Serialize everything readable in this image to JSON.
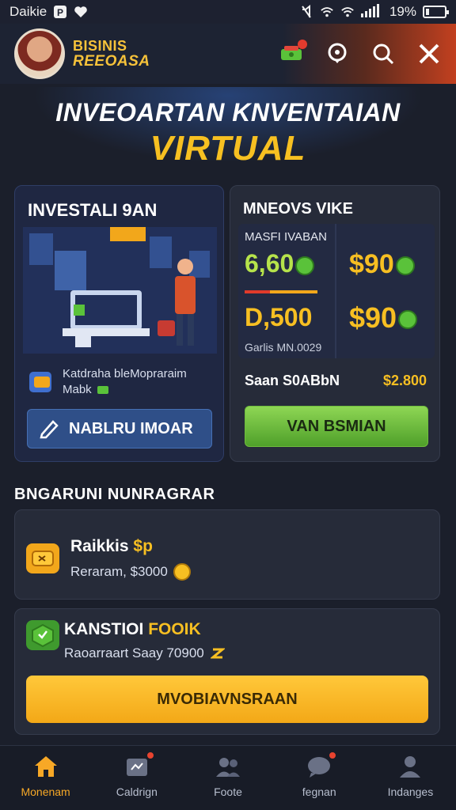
{
  "status_bar": {
    "app_name": "Daikie",
    "battery": "19%",
    "battery_fraction": 0.19
  },
  "header": {
    "brand_line1": "BISINIS",
    "brand_line2": "REEOASA"
  },
  "hero": {
    "line1": "INVEOARTAN KNVENTAIAN",
    "line2": "VIRTUAL"
  },
  "invest_card": {
    "title": "INVESTALI 9AN",
    "note_line1": "Katdraha bleMopraraim",
    "note_line2": "Mabk",
    "button_label": "NABLRU IMOAR"
  },
  "prices_card": {
    "title": "MNEOVS VIKE",
    "inner_label": "MASFI IVABAN",
    "price_a": "6,60",
    "price_b": "$90",
    "price_c": "D,500",
    "price_d": "$90",
    "foot": "Garlis MN.0029",
    "sale_label": "Saan S0ABbN",
    "sale_value": "$2.800",
    "buy_label": "VAN BSMIAN"
  },
  "section": {
    "title": "BNGARUNI NUNRAGRAR"
  },
  "items": [
    {
      "title": "Raikkis",
      "title_accent": "$p",
      "subtitle": "Reraram, $3000"
    },
    {
      "title": "KANSTIOI",
      "title_accent": "FOOIK",
      "subtitle": "Raoarraart Saay 70900",
      "button_label": "MVOBIAVNSRAAN"
    }
  ],
  "bottom_nav": [
    {
      "label": "Monenam",
      "icon": "home-icon",
      "active": true,
      "badge": false
    },
    {
      "label": "Caldrign",
      "icon": "calendar-icon",
      "active": false,
      "badge": true
    },
    {
      "label": "Foote",
      "icon": "people-icon",
      "active": false,
      "badge": false
    },
    {
      "label": "fegnan",
      "icon": "chat-icon",
      "active": false,
      "badge": true
    },
    {
      "label": "Indanges",
      "icon": "profile-icon",
      "active": false,
      "badge": false
    }
  ],
  "colors": {
    "accent_gold": "#f7bf22",
    "accent_green": "#5ac23a",
    "header_red": "#c2401f",
    "background": "#1b1f2b"
  }
}
